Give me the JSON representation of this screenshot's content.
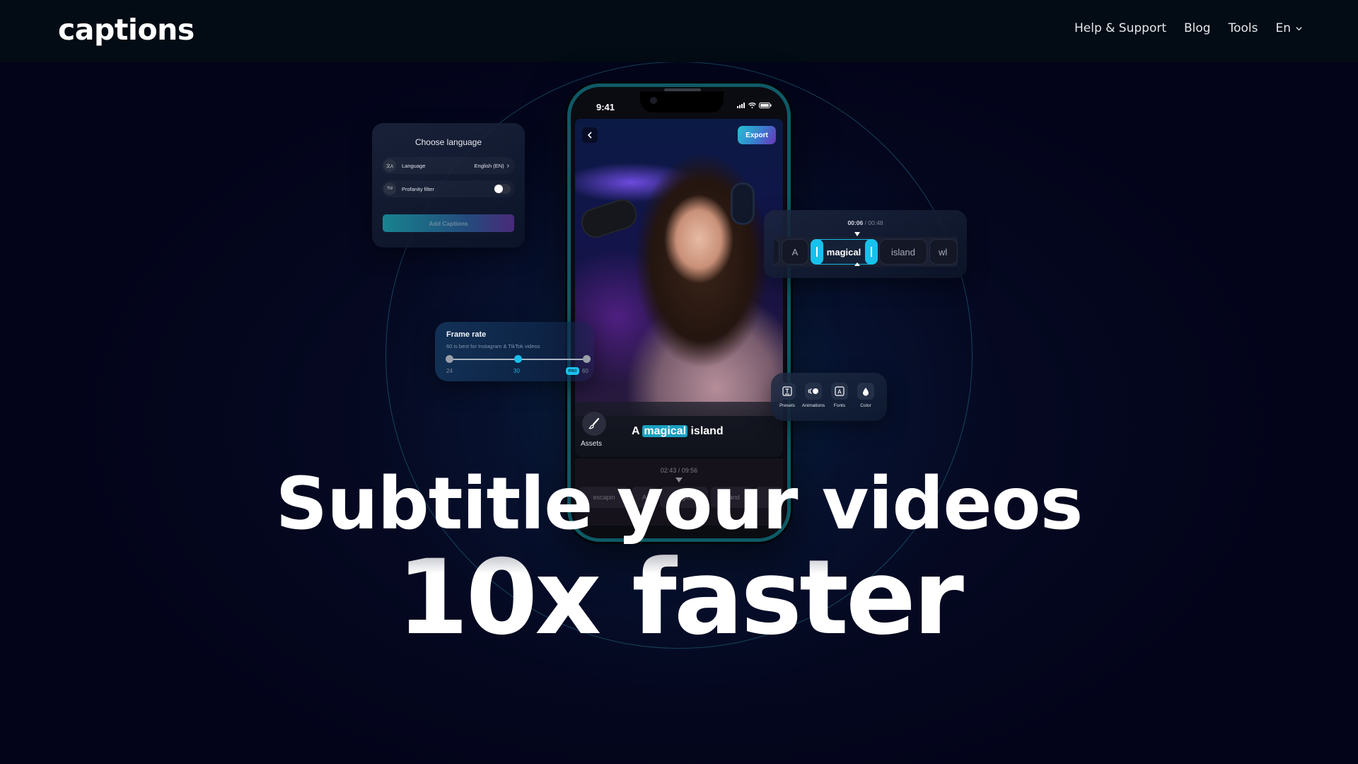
{
  "brand": {
    "logo_text": "captions"
  },
  "nav": {
    "links": [
      {
        "label": "Help & Support"
      },
      {
        "label": "Blog"
      },
      {
        "label": "Tools"
      }
    ],
    "language": {
      "label": "En",
      "icon": "chevron-down-icon"
    }
  },
  "hero": {
    "headline_line1": "Subtitle your videos",
    "headline_line2": "10x faster"
  },
  "phone": {
    "status_time": "9:41",
    "status_icons": [
      "signal-icon",
      "wifi-icon",
      "battery-icon"
    ],
    "back_icon": "chevron-left-icon",
    "export_label": "Export",
    "assets_label": "Assets",
    "assets_icon": "brush-icon",
    "caption": {
      "before": "A",
      "highlight": "magical",
      "after": "island"
    },
    "timeline_current": "02:43",
    "timeline_total": "09:56",
    "timeline_words": [
      "escapin",
      "A",
      "magical",
      "island",
      ""
    ]
  },
  "language_card": {
    "title": "Choose language",
    "language_row": {
      "icon": "translate-icon",
      "icon_text": "文A",
      "label": "Language",
      "value": "English (EN)"
    },
    "profanity_row": {
      "icon": "profanity-icon",
      "icon_text": "?!#",
      "label": "Profanity filter",
      "enabled": false
    },
    "button_label": "Add Captions"
  },
  "timeline_card": {
    "current": "00:06",
    "total": "/ 00:48",
    "words": [
      "",
      "A",
      "magical",
      "island",
      "wl"
    ],
    "selected_word": "magical"
  },
  "frame_rate_card": {
    "title": "Frame rate",
    "subtitle": "60 is best for Instagram & TikTok videos",
    "options": [
      "24",
      "30",
      "60"
    ],
    "selected": "30",
    "pro_badge": "PRO",
    "accent": "#19c0ec"
  },
  "style_toolbar": {
    "tools": [
      {
        "label": "Presets",
        "icon": "presets-icon"
      },
      {
        "label": "Animations",
        "icon": "animations-icon"
      },
      {
        "label": "Fonts",
        "icon": "fonts-icon"
      },
      {
        "label": "Color",
        "icon": "color-drop-icon"
      }
    ]
  },
  "colors": {
    "background": "#03041a",
    "nav_background": "#030b14",
    "accent_cyan": "#19c0ec",
    "phone_frame": "#0e5a66"
  }
}
